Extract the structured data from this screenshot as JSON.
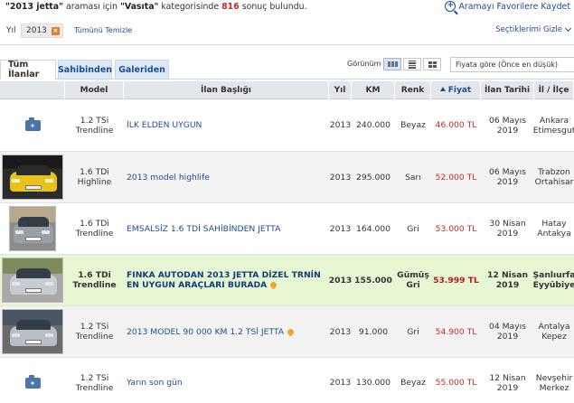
{
  "top": {
    "query": "\"2013 jetta\"",
    "mid": " araması için ",
    "category": "\"Vasıta\"",
    "mid2": " kategorisinde ",
    "count": "816",
    "tail": " sonuç bulundu.",
    "save_search": "Aramayı Favorilere Kaydet"
  },
  "filters": {
    "year_label": "Yıl",
    "year_chip": "2013",
    "clear_all": "Tümünü Temizle",
    "hide_selected": "Seçtiklerimi Gizle"
  },
  "tabs": [
    {
      "label": "Tüm İlanlar"
    },
    {
      "label": "Sahibinden"
    },
    {
      "label": "Galeriden"
    }
  ],
  "view": {
    "label": "Görünüm",
    "sort_selected": "Fiyata göre (Önce en düşük)"
  },
  "columns": {
    "model": "Model",
    "title": "İlan Başlığı",
    "year": "Yıl",
    "km": "KM",
    "color": "Renk",
    "price": "Fiyat",
    "date": "İlan Tarihi",
    "location": "İl / İlçe"
  },
  "listings": [
    {
      "thumb": "camera-icon",
      "model_line1": "1.2 TSi",
      "model_line2": "Trendline",
      "title": "İLK ELDEN UYGUN",
      "year": "2013",
      "km": "240.000",
      "color_line1": "Beyaz",
      "color_line2": "",
      "price": "46.000 TL",
      "date_line1": "06 Mayıs",
      "date_line2": "2019",
      "loc_line1": "Ankara",
      "loc_line2": "Etimesgut"
    },
    {
      "thumb": "photo-yellow",
      "model_line1": "1.6 TDi",
      "model_line2": "Highline",
      "title": "2013 model highlife",
      "year": "2013",
      "km": "295.000",
      "color_line1": "Sarı",
      "color_line2": "",
      "price": "52.000 TL",
      "date_line1": "06 Mayıs",
      "date_line2": "2019",
      "loc_line1": "Trabzon",
      "loc_line2": "Ortahisar"
    },
    {
      "thumb": "photo-grey",
      "model_line1": "1.6 TDi",
      "model_line2": "Trendline",
      "title": "EMSALSİZ 1.6 TDİ SAHİBİNDEN JETTA",
      "year": "2013",
      "km": "164.000",
      "color_line1": "Gri",
      "color_line2": "",
      "price": "53.000 TL",
      "date_line1": "30 Nisan",
      "date_line2": "2019",
      "loc_line1": "Hatay",
      "loc_line2": "Antakya"
    },
    {
      "thumb": "photo-grey",
      "model_line1": "1.6 TDi",
      "model_line2": "Trendline",
      "title": "FINKA AUTODAN 2013 JETTA DİZEL TRNİN EN UYGUN ARAÇLARI BURADA",
      "year": "2013",
      "km": "155.000",
      "color_line1": "Gümüş",
      "color_line2": "Gri",
      "price": "53.999 TL",
      "date_line1": "12 Nisan",
      "date_line2": "2019",
      "loc_line1": "Şanlıurfa",
      "loc_line2": "Eyyübiye"
    },
    {
      "thumb": "photo-silver",
      "model_line1": "1.2 TSi",
      "model_line2": "Trendline",
      "title": "2013 MODEL 90 000 KM 1.2 TSİ JETTA",
      "year": "2013",
      "km": "91.000",
      "color_line1": "Gri",
      "color_line2": "",
      "price": "54.900 TL",
      "date_line1": "04 Mayıs",
      "date_line2": "2019",
      "loc_line1": "Antalya",
      "loc_line2": "Kepez"
    },
    {
      "thumb": "camera-icon",
      "model_line1": "1.2 TSi",
      "model_line2": "Trendline",
      "title": "Yarın son gün",
      "year": "2013",
      "km": "130.000",
      "color_line1": "Beyaz",
      "color_line2": "",
      "price": "55.000 TL",
      "date_line1": "12 Nisan",
      "date_line2": "2019",
      "loc_line1": "Nevşehir",
      "loc_line2": "Merkez"
    }
  ],
  "colors": {
    "link": "#1e4c91",
    "price": "#c62828",
    "highlight_row": "#e7f7d3",
    "accent_orange": "#e67a2e"
  }
}
